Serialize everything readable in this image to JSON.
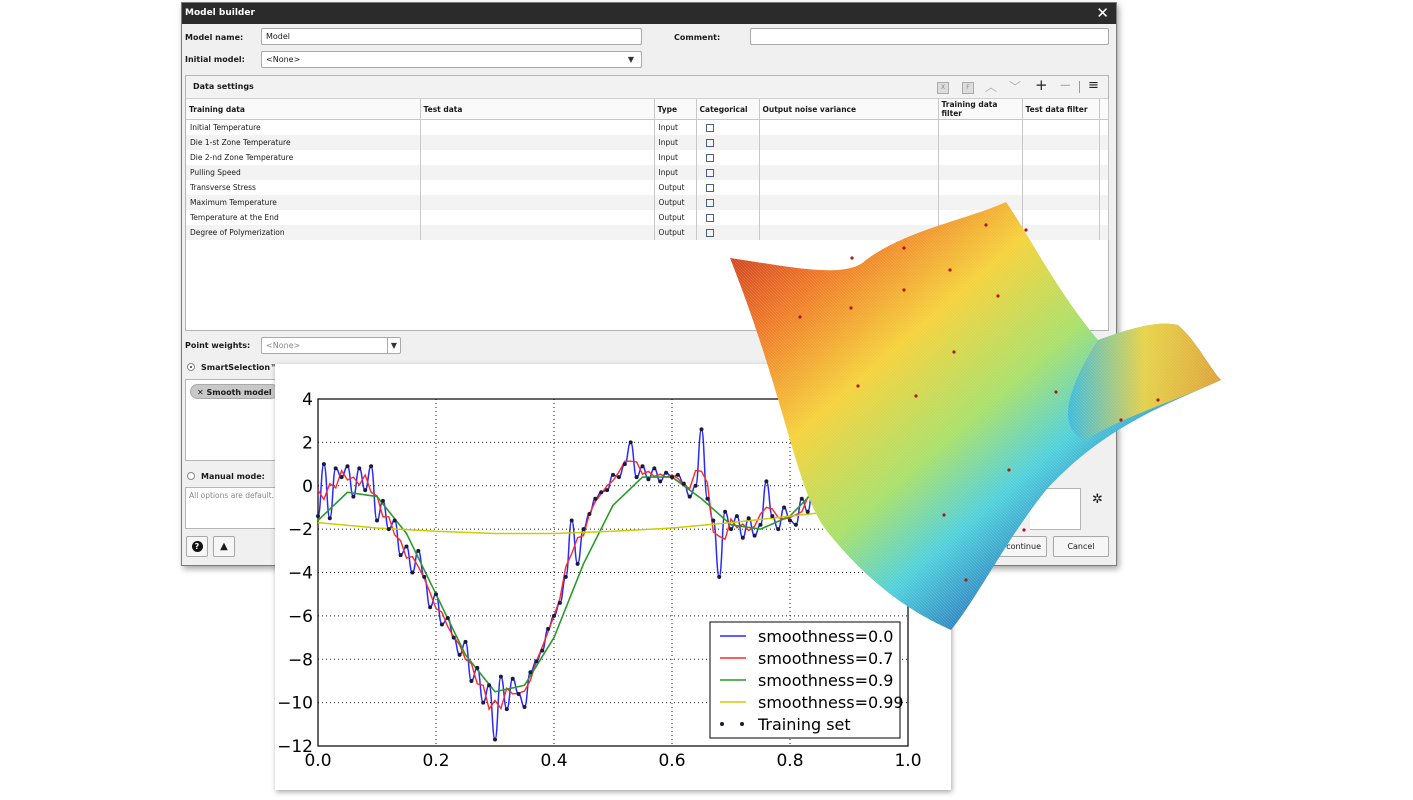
{
  "window": {
    "title": "Model builder",
    "close_glyph": "✕"
  },
  "form": {
    "model_name_label": "Model name:",
    "model_name_value": "Model",
    "comment_label": "Comment:",
    "comment_value": "",
    "initial_model_label": "Initial model:",
    "initial_model_value": "<None>"
  },
  "data_settings": {
    "title": "Data settings",
    "toolbar_icons": [
      "x-box-icon",
      "f-box-icon",
      "arrow-up-icon",
      "arrow-down-icon",
      "plus-icon",
      "minus-icon",
      "menu-icon"
    ],
    "toolbar_glyphs": {
      "x": "X",
      "f": "F",
      "up": "︿",
      "down": "﹀",
      "plus": "+",
      "minus": "−",
      "menu": "≡"
    },
    "columns": [
      "Training data",
      "Test data",
      "Type",
      "Categorical",
      "Output noise variance",
      "Training data filter",
      "Test data filter"
    ],
    "rows": [
      {
        "training": "Initial Temperature",
        "type": "Input"
      },
      {
        "training": "Die 1-st Zone Temperature",
        "type": "Input"
      },
      {
        "training": "Die 2-nd Zone Temperature",
        "type": "Input"
      },
      {
        "training": "Pulling Speed",
        "type": "Input"
      },
      {
        "training": "Transverse Stress",
        "type": "Output"
      },
      {
        "training": "Maximum Temperature",
        "type": "Output"
      },
      {
        "training": "Temperature at the End",
        "type": "Output"
      },
      {
        "training": "Degree of Polymerization",
        "type": "Output"
      }
    ]
  },
  "point_weights": {
    "label": "Point weights:",
    "value": "<None>"
  },
  "smart_selection": {
    "label": "SmartSelection™ m",
    "chip_label": "Smooth model",
    "chip_close": "✕"
  },
  "manual_mode": {
    "label": "Manual mode:",
    "placeholder": "All options are default."
  },
  "buttons": {
    "help": "?",
    "warning": "▲",
    "continue": "continue",
    "cancel": "Cancel",
    "settings_glyph": "✲"
  },
  "colors": {
    "titlebar": "#2b2b2b",
    "series_0": "#2a2aff",
    "series_1": "#ff2a2a",
    "series_2": "#2a9a2a",
    "series_3": "#cccc00",
    "points": "#1a1a3a"
  },
  "chart_data": {
    "type": "line",
    "xlim": [
      0.0,
      1.0
    ],
    "ylim": [
      -12,
      4
    ],
    "xticks": [
      "0.0",
      "0.2",
      "0.4",
      "0.6",
      "0.8",
      "1.0"
    ],
    "yticks": [
      "4",
      "2",
      "0",
      "−2",
      "−4",
      "−6",
      "−8",
      "−10",
      "−12"
    ],
    "grid": true,
    "legend_position": "bottom-right",
    "series": [
      {
        "name": "smoothness=0.0"
      },
      {
        "name": "smoothness=0.7"
      },
      {
        "name": "smoothness=0.9"
      },
      {
        "name": "smoothness=0.99"
      },
      {
        "name": "Training set"
      }
    ],
    "smooth_curve": {
      "x": [
        0.0,
        0.05,
        0.1,
        0.15,
        0.2,
        0.25,
        0.3,
        0.35,
        0.4,
        0.45,
        0.5,
        0.55,
        0.6,
        0.65,
        0.7,
        0.75,
        0.8,
        0.85,
        0.9,
        0.95,
        1.0
      ],
      "y": [
        -1.6,
        -0.3,
        -0.5,
        -2.2,
        -5.0,
        -7.8,
        -9.5,
        -9.2,
        -7.0,
        -3.6,
        -0.9,
        0.4,
        0.4,
        -0.6,
        -1.8,
        -2.0,
        -1.4,
        0.0,
        1.2,
        1.5,
        1.0
      ]
    },
    "very_smooth_curve": {
      "x": [
        0.0,
        0.1,
        0.2,
        0.3,
        0.4,
        0.5,
        0.6,
        0.7,
        0.8,
        0.9,
        1.0
      ],
      "y": [
        -1.7,
        -1.95,
        -2.1,
        -2.2,
        -2.2,
        -2.1,
        -1.95,
        -1.7,
        -1.4,
        -1.1,
        -0.8
      ]
    },
    "training_set": {
      "x": [
        0.0,
        0.01,
        0.02,
        0.03,
        0.04,
        0.05,
        0.06,
        0.07,
        0.08,
        0.09,
        0.1,
        0.11,
        0.12,
        0.13,
        0.14,
        0.15,
        0.16,
        0.17,
        0.18,
        0.19,
        0.2,
        0.21,
        0.22,
        0.23,
        0.24,
        0.25,
        0.26,
        0.27,
        0.28,
        0.29,
        0.3,
        0.31,
        0.32,
        0.33,
        0.34,
        0.35,
        0.36,
        0.37,
        0.38,
        0.39,
        0.4,
        0.41,
        0.42,
        0.43,
        0.44,
        0.45,
        0.46,
        0.47,
        0.48,
        0.49,
        0.5,
        0.51,
        0.52,
        0.53,
        0.54,
        0.55,
        0.56,
        0.57,
        0.58,
        0.59,
        0.6,
        0.61,
        0.62,
        0.63,
        0.64,
        0.65,
        0.66,
        0.67,
        0.68,
        0.69,
        0.7,
        0.71,
        0.72,
        0.73,
        0.74,
        0.75,
        0.76,
        0.77,
        0.78,
        0.79,
        0.8,
        0.81,
        0.82,
        0.83,
        0.84,
        0.85
      ],
      "y": [
        -1.4,
        1.0,
        -1.5,
        0.8,
        0.4,
        0.9,
        -0.5,
        0.8,
        -0.2,
        0.9,
        -1.6,
        -0.7,
        -2.0,
        -1.6,
        -3.2,
        -2.8,
        -4.0,
        -3.0,
        -4.2,
        -5.6,
        -5.0,
        -6.4,
        -6.1,
        -7.0,
        -7.8,
        -7.2,
        -9.0,
        -8.4,
        -10.0,
        -9.2,
        -11.7,
        -8.8,
        -10.3,
        -8.9,
        -9.6,
        -10.2,
        -8.6,
        -8.1,
        -7.6,
        -6.6,
        -6.0,
        -5.4,
        -4.2,
        -1.6,
        -3.6,
        -2.0,
        -1.3,
        -0.6,
        -0.3,
        -0.2,
        0.5,
        0.4,
        1.0,
        2.0,
        0.4,
        0.9,
        0.3,
        0.8,
        0.2,
        0.6,
        0.4,
        0.5,
        0.1,
        -0.5,
        0.0,
        2.6,
        -0.6,
        -1.6,
        -4.2,
        -1.2,
        -2.0,
        -1.4,
        -2.4,
        -1.5,
        -2.3,
        -1.8,
        0.2,
        -1.4,
        -2.0,
        -1.0,
        -1.6,
        -1.8,
        -0.6,
        -1.2,
        0.2,
        0.1
      ]
    }
  }
}
